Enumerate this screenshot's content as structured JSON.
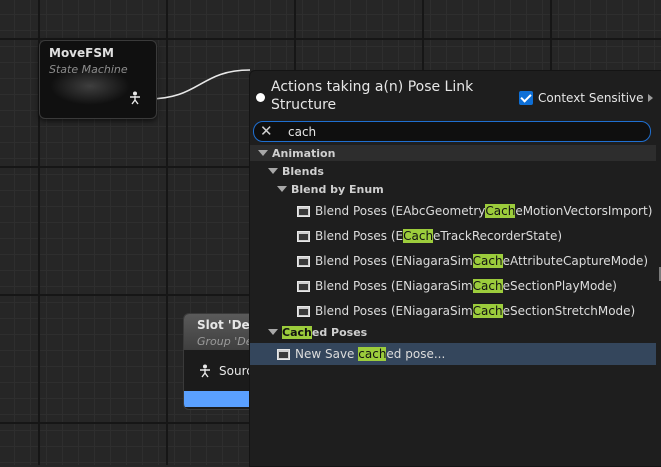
{
  "graph": {
    "fsm_node": {
      "title": "MoveFSM",
      "subtitle": "State Machine"
    },
    "slot_node": {
      "title": "Slot 'Def",
      "subtitle": "Group 'De",
      "pin_label": "Sourc"
    }
  },
  "menu": {
    "title": "Actions taking a(n) Pose Link Structure",
    "context_sensitive_label": "Context Sensitive",
    "context_sensitive_checked": true,
    "search_value": "cach",
    "tree": [
      {
        "type": "category",
        "indent": 0,
        "label": "Animation"
      },
      {
        "type": "category",
        "indent": 1,
        "label": "Blends"
      },
      {
        "type": "category",
        "indent": 2,
        "label": "Blend by Enum"
      },
      {
        "type": "item",
        "indent": 3,
        "pre": "Blend Poses (EAbcGeometry",
        "match": "Cach",
        "post": "eMotionVectorsImport)"
      },
      {
        "type": "item",
        "indent": 3,
        "pre": "Blend Poses (E",
        "match": "Cach",
        "post": "eTrackRecorderState)"
      },
      {
        "type": "item",
        "indent": 3,
        "pre": "Blend Poses (ENiagaraSim",
        "match": "Cach",
        "post": "eAttributeCaptureMode)"
      },
      {
        "type": "item",
        "indent": 3,
        "pre": "Blend Poses (ENiagaraSim",
        "match": "Cach",
        "post": "eSectionPlayMode)"
      },
      {
        "type": "item",
        "indent": 3,
        "pre": "Blend Poses (ENiagaraSim",
        "match": "Cach",
        "post": "eSectionStretchMode)"
      },
      {
        "type": "category",
        "indent": 1,
        "pre": "",
        "match": "Cach",
        "post": "ed Poses"
      },
      {
        "type": "item",
        "indent": 2,
        "pre": "New Save ",
        "match": "cach",
        "post": "ed pose...",
        "selected": true
      }
    ]
  },
  "colors": {
    "accent": "#1f6fd0",
    "highlight": "#9ccc3c",
    "selection": "#34465c",
    "slot_bar": "#5aa0ff"
  }
}
